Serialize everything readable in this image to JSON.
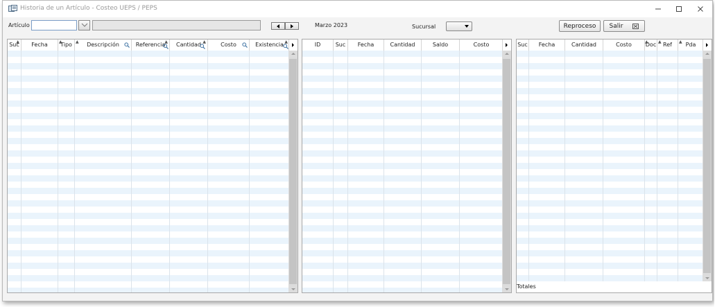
{
  "window": {
    "title": "Historia de un Artículo - Costeo UEPS / PEPS",
    "controls": [
      "minimize-icon",
      "maximize-icon",
      "close-icon"
    ]
  },
  "toolbar": {
    "articulo_label": "Artículo",
    "articulo_value": "",
    "articulo_description": "",
    "period_label": "Marzo 2023",
    "sucursal_label": "Sucursal",
    "sucursal_value": "",
    "reproceso_label": "Reproceso",
    "salir_label": "Salir"
  },
  "grid_movimientos": {
    "columns": [
      {
        "label": "Suc",
        "sort": true,
        "search": false
      },
      {
        "label": "Fecha",
        "sort": false,
        "search": false
      },
      {
        "label": "Tipo",
        "sort": true,
        "search": false
      },
      {
        "label": "Descripción",
        "sort": false,
        "search": true
      },
      {
        "label": "Referencia",
        "sort": true,
        "search": true
      },
      {
        "label": "Cantidad",
        "sort": true,
        "search": true
      },
      {
        "label": "Costo",
        "sort": false,
        "search": true
      },
      {
        "label": "Existencia",
        "sort": true,
        "search": true
      }
    ],
    "rows": []
  },
  "grid_capas": {
    "columns": [
      {
        "label": "ID"
      },
      {
        "label": "Suc"
      },
      {
        "label": "Fecha"
      },
      {
        "label": "Cantidad"
      },
      {
        "label": "Saldo"
      },
      {
        "label": "Costo"
      }
    ],
    "rows": []
  },
  "grid_salidas": {
    "columns": [
      {
        "label": "Suc",
        "sort": false
      },
      {
        "label": "Fecha",
        "sort": false
      },
      {
        "label": "Cantidad",
        "sort": false
      },
      {
        "label": "Costo",
        "sort": false
      },
      {
        "label": "Doc",
        "sort": true
      },
      {
        "label": "Ref",
        "sort": true
      },
      {
        "label": "Pda",
        "sort": true
      }
    ],
    "rows": [],
    "totals_label": "Totales"
  },
  "colors": {
    "row_alt": "#eaf4fc",
    "title_text": "#999999",
    "input_border": "#7a9cc6"
  }
}
